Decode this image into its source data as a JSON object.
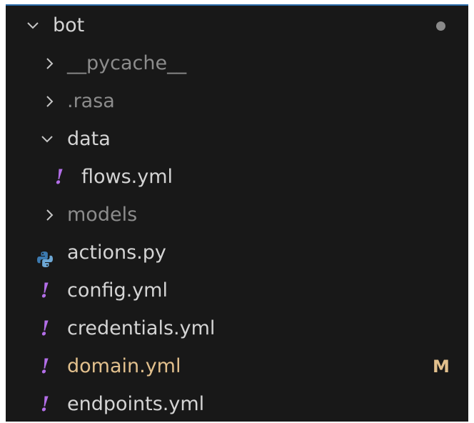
{
  "explorer": {
    "root": {
      "label": "bot"
    },
    "items": [
      {
        "label": "__pycache__"
      },
      {
        "label": ".rasa"
      },
      {
        "label": "data"
      },
      {
        "label": "flows.yml"
      },
      {
        "label": "models"
      },
      {
        "label": "actions.py"
      },
      {
        "label": "config.yml"
      },
      {
        "label": "credentials.yml"
      },
      {
        "label": "domain.yml",
        "badge": "M"
      },
      {
        "label": "endpoints.yml"
      }
    ]
  },
  "colors": {
    "background": "#181818",
    "yaml_icon": "#b36ee8",
    "modified": "#e2c08d",
    "muted": "#8c8c8c",
    "python_blue": "#3c7ab0",
    "python_yellow": "#f0c94a"
  },
  "icons": {
    "expanded": "chevron-down-icon",
    "collapsed": "chevron-right-icon",
    "yaml": "yaml-exclamation-icon",
    "python": "python-icon",
    "unsaved": "modified-dot-icon"
  }
}
